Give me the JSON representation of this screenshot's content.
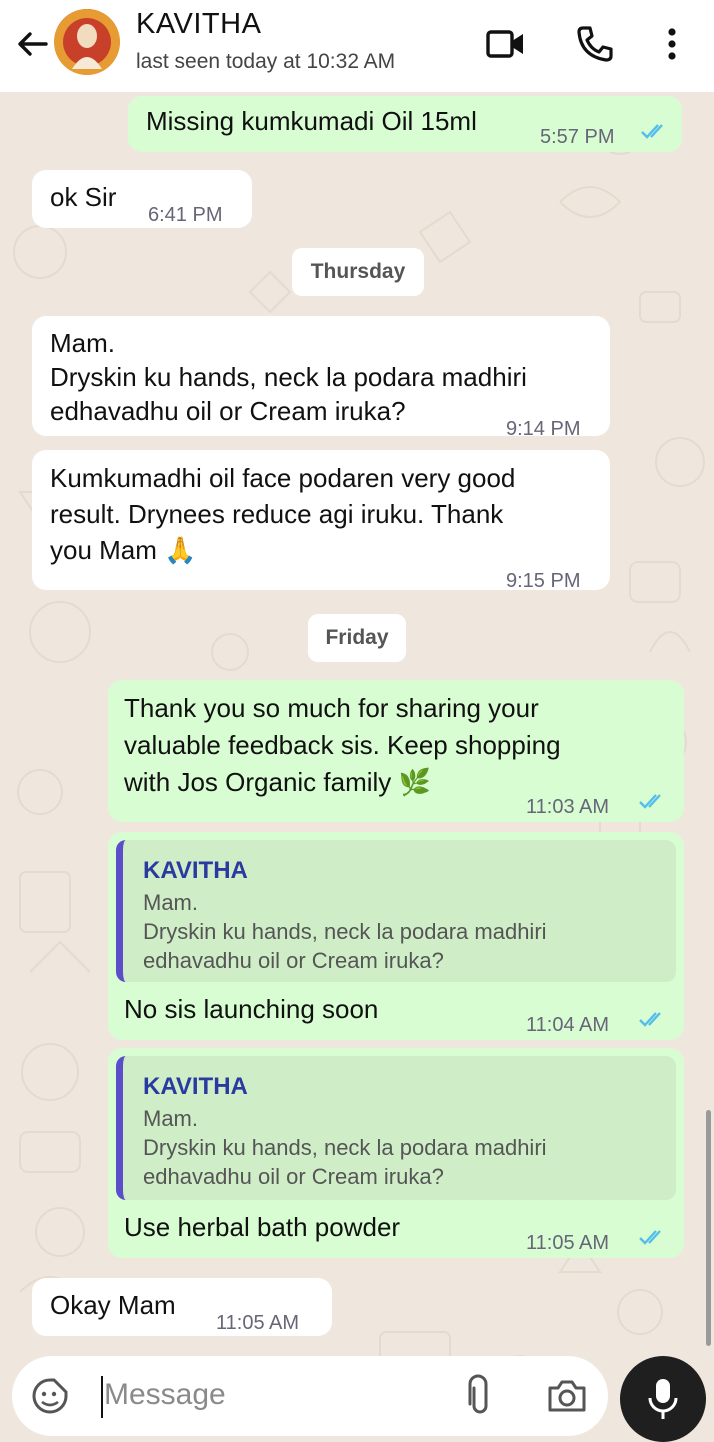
{
  "header": {
    "contact_name": "KAVITHA",
    "status": "last seen today at 10:32 AM",
    "icons": [
      "back-arrow-icon",
      "video-call-icon",
      "voice-call-icon",
      "more-options-icon"
    ]
  },
  "messages": [
    {
      "dir": "out",
      "text": "Missing kumkumadi Oil 15ml",
      "time": "5:57 PM"
    },
    {
      "dir": "in",
      "text": "ok Sir",
      "time": "6:41 PM"
    },
    {
      "day": "Thursday"
    },
    {
      "dir": "in",
      "text": "Mam.\nDryskin ku hands, neck la podara madhiri edhavadhu oil or Cream iruka?",
      "time": "9:14 PM"
    },
    {
      "dir": "in",
      "text": "Kumkumadhi oil face podaren very good result. Drynees reduce agi iruku. Thank you Mam 🙏",
      "time": "9:15 PM"
    },
    {
      "day": "Friday"
    },
    {
      "dir": "out",
      "text": "Thank you so much for sharing your valuable feedback sis. Keep shopping with Jos Organic family 🌿",
      "time": "11:03 AM"
    },
    {
      "dir": "out",
      "quote_name": "KAVITHA",
      "quote_text": "Mam.\nDryskin ku hands, neck la podara madhiri edhavadhu oil or Cream iruka?",
      "text": "No sis launching soon",
      "time": "11:04 AM"
    },
    {
      "dir": "out",
      "quote_name": "KAVITHA",
      "quote_text": "Mam.\nDryskin ku hands, neck la podara madhiri edhavadhu oil or Cream iruka?",
      "text": "Use herbal bath powder",
      "time": "11:05 AM"
    },
    {
      "dir": "in",
      "text": "Okay Mam",
      "time": "11:05 AM"
    }
  ],
  "lines": {
    "m0": "Missing kumkumadi Oil 15ml",
    "m1": "ok Sir",
    "m3a": "Mam.",
    "m3b": "Dryskin ku hands, neck la podara madhiri",
    "m3c": "edhavadhu oil or Cream iruka?",
    "m4a": "Kumkumadhi oil face podaren very good",
    "m4b": "result. Drynees reduce agi iruku. Thank",
    "m4c": "you Mam 🙏",
    "m6a": "Thank you so much for sharing your",
    "m6b": "valuable feedback sis. Keep shopping",
    "m6c": "with Jos Organic family 🌿",
    "q1": "Mam.",
    "q2": "Dryskin ku hands, neck la podara madhiri",
    "q3": "edhavadhu oil or Cream iruka?"
  },
  "days": {
    "d1": "Thursday",
    "d2": "Friday"
  },
  "times": {
    "t0": "5:57 PM",
    "t1": "6:41 PM",
    "t3": "9:14 PM",
    "t4": "9:15 PM",
    "t6": "11:03 AM",
    "t7": "11:04 AM",
    "t8": "11:05 AM",
    "t9": "11:05 AM"
  },
  "replies": {
    "r7": "No sis launching soon",
    "r8": "Use herbal bath powder",
    "r9": "Okay Mam",
    "qname": "KAVITHA"
  },
  "composer": {
    "placeholder": "Message",
    "icons": [
      "emoji-sticker-icon",
      "attach-icon",
      "camera-icon",
      "mic-icon"
    ]
  },
  "colors": {
    "incoming": "#ffffff",
    "outgoing": "#d9fdd3",
    "read_ticks": "#53bdeb",
    "wallpaper": "#efe7dd",
    "quote_bar": "#5b4fc9"
  }
}
